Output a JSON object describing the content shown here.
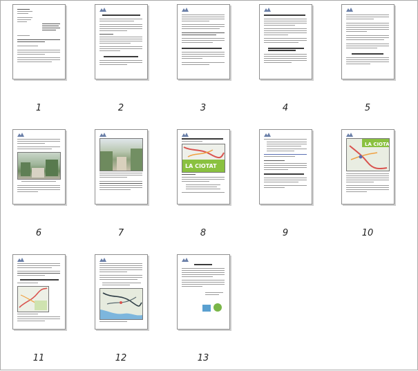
{
  "viewer": {
    "name": "pdf-page-thumbnails",
    "accent": "#8e8e8e"
  },
  "pages": [
    {
      "number": "1"
    },
    {
      "number": "2"
    },
    {
      "number": "3"
    },
    {
      "number": "4"
    },
    {
      "number": "5"
    },
    {
      "number": "6"
    },
    {
      "number": "7"
    },
    {
      "number": "8"
    },
    {
      "number": "9"
    },
    {
      "number": "10"
    },
    {
      "number": "11"
    },
    {
      "number": "12"
    },
    {
      "number": "13"
    }
  ],
  "map_texts": {
    "page8_banner": "LA CIOTAT",
    "page10_banner": "LA CIOTAT"
  },
  "colors": {
    "green_banner": "#8ac140",
    "road_red": "#d9534f",
    "road_orange": "#f0a040",
    "sea_blue": "#7db6dd",
    "land": "#e9ede2"
  }
}
